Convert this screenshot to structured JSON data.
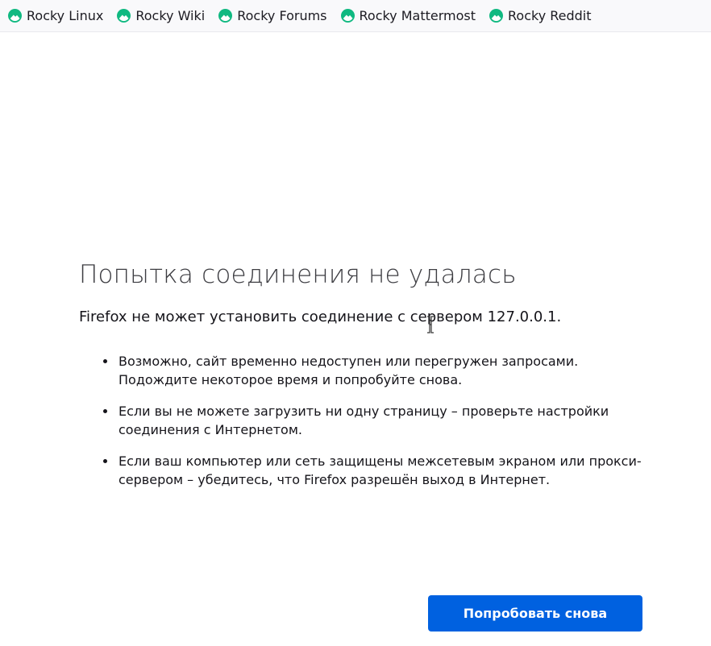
{
  "bookmarks": [
    {
      "label": "Rocky Linux",
      "icon": "rocky-logo-icon"
    },
    {
      "label": "Rocky Wiki",
      "icon": "rocky-logo-icon"
    },
    {
      "label": "Rocky Forums",
      "icon": "rocky-logo-icon"
    },
    {
      "label": "Rocky Mattermost",
      "icon": "rocky-logo-icon"
    },
    {
      "label": "Rocky Reddit",
      "icon": "rocky-logo-icon"
    }
  ],
  "error": {
    "title": "Попытка соединения не удалась",
    "description": "Firefox не может установить соединение с сервером 127.0.0.1.",
    "suggestions": [
      "Возможно, сайт временно недоступен или перегружен запросами. Подождите некоторое время и попробуйте снова.",
      "Если вы не можете загрузить ни одну страницу – проверьте настройки соединения с Интернетом.",
      "Если ваш компьютер или сеть защищены межсетевым экраном или прокси-сервером – убедитесь, что Firefox разрешён выход в Интернет."
    ],
    "retry_label": "Попробовать снова"
  },
  "colors": {
    "accent": "#0061e0",
    "rocky_green": "#10b981"
  }
}
